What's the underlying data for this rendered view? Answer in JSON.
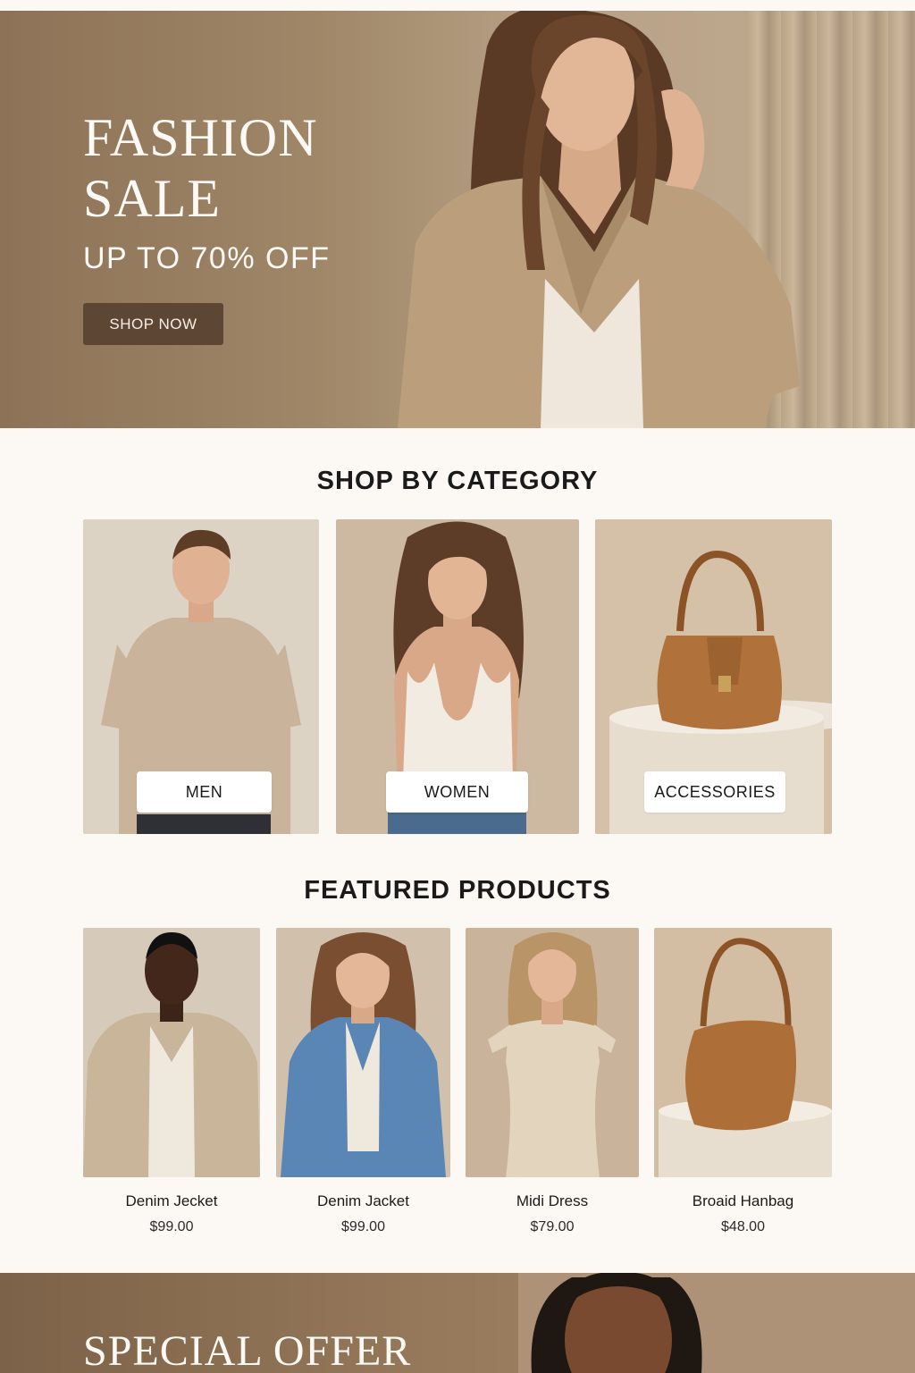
{
  "hero": {
    "title": "FASHION SALE",
    "subtitle": "UP TO 70% OFF",
    "cta_label": "SHOP NOW"
  },
  "categories": {
    "title": "SHOP BY CATEGORY",
    "items": [
      {
        "label": "MEN"
      },
      {
        "label": "WOMEN"
      },
      {
        "label": "ACCESSORIES"
      }
    ]
  },
  "featured": {
    "title": "FEATURED PRODUCTS",
    "products": [
      {
        "name": "Denim Jecket",
        "price": "$99.00"
      },
      {
        "name": "Denim Jacket",
        "price": "$99.00"
      },
      {
        "name": "Midi Dress",
        "price": "$79.00"
      },
      {
        "name": "Broaid Hanbag",
        "price": "$48.00"
      }
    ]
  },
  "offer": {
    "title": "SPECIAL OFFER"
  },
  "colors": {
    "page_bg": "#fcf9f4",
    "accent_button": "#5e4634",
    "hero_tone": "#a08768"
  }
}
